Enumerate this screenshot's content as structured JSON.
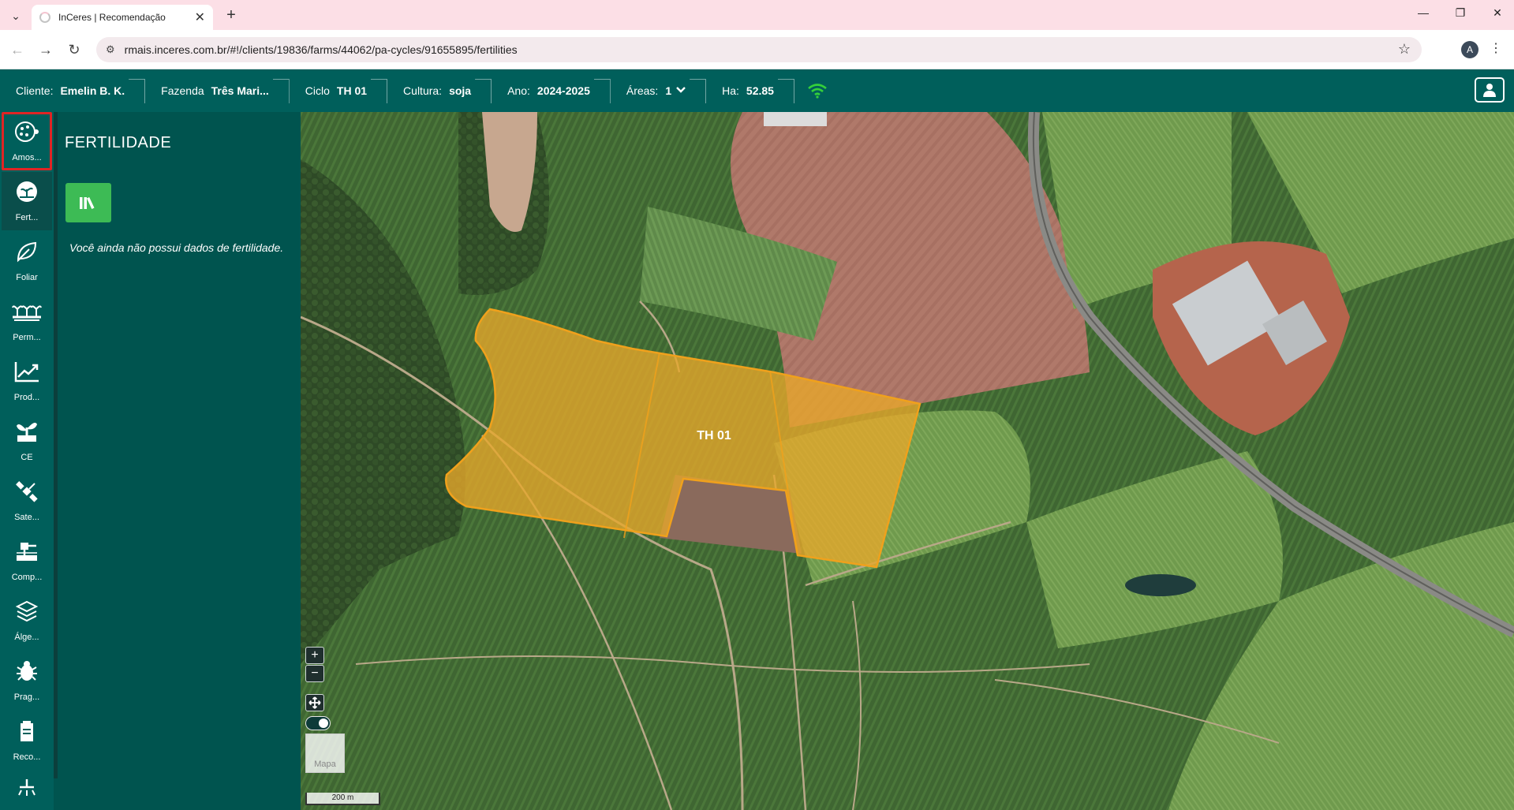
{
  "browser": {
    "tab_title": "InCeres | Recomendação",
    "url": "rmais.inceres.com.br/#!/clients/19836/farms/44062/pa-cycles/91655895/fertilities",
    "profile_initial": "A"
  },
  "header": {
    "cliente_label": "Cliente:",
    "cliente_value": "Emelin B. K.",
    "fazenda_label": "Fazenda",
    "fazenda_value": "Três Mari...",
    "ciclo_label": "Ciclo",
    "ciclo_value": "TH 01",
    "cultura_label": "Cultura:",
    "cultura_value": "soja",
    "ano_label": "Ano:",
    "ano_value": "2024-2025",
    "areas_label": "Áreas:",
    "areas_value": "1",
    "ha_label": "Ha:",
    "ha_value": "52.85",
    "wifi_color": "#34d03a"
  },
  "sidebar": {
    "items": [
      {
        "label": "Amos...",
        "icon": "sampling-icon"
      },
      {
        "label": "Fert...",
        "icon": "fertility-icon"
      },
      {
        "label": "Foliar",
        "icon": "leaf-icon"
      },
      {
        "label": "Perm...",
        "icon": "plants-icon"
      },
      {
        "label": "Prod...",
        "icon": "chart-line-icon"
      },
      {
        "label": "CE",
        "icon": "sprout-icon"
      },
      {
        "label": "Sate...",
        "icon": "satellite-icon"
      },
      {
        "label": "Comp...",
        "icon": "compaction-icon"
      },
      {
        "label": "Álge...",
        "icon": "layers-icon"
      },
      {
        "label": "Prag...",
        "icon": "bug-icon"
      },
      {
        "label": "Reco...",
        "icon": "recommendation-icon"
      }
    ]
  },
  "panel": {
    "title": "FERTILIDADE",
    "message": "Você ainda não possui dados de fertilidade."
  },
  "map": {
    "field_label": "TH 01",
    "zoom_in": "+",
    "zoom_out": "−",
    "mapa_label": "Mapa",
    "scale_label": "200 m",
    "field_color": "#e8a82a"
  }
}
